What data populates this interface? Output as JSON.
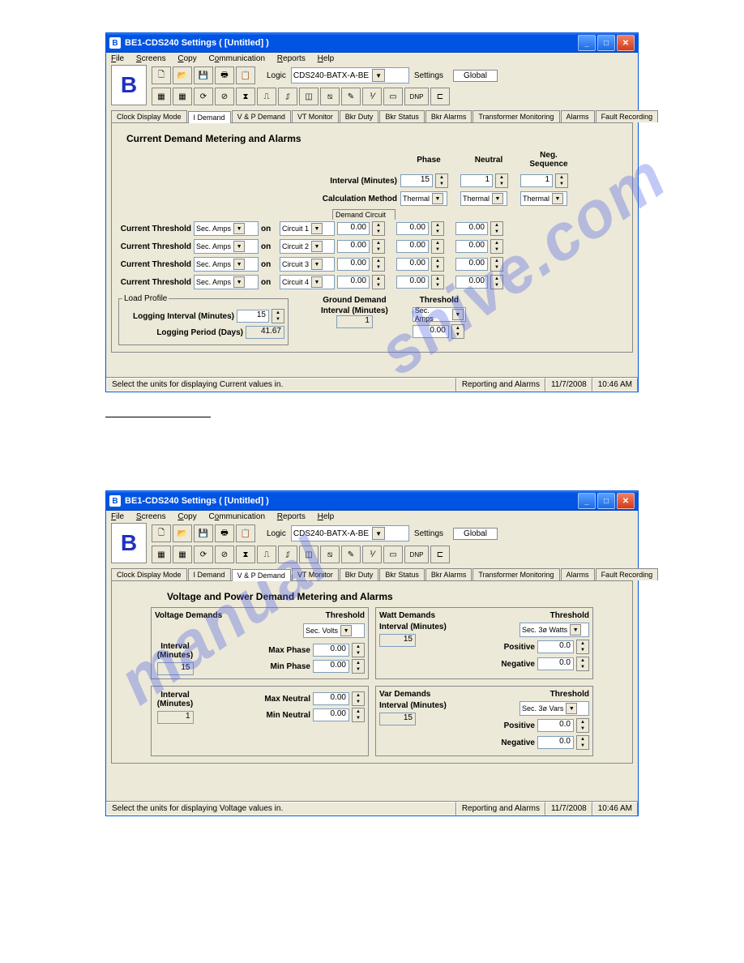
{
  "window": {
    "title": "BE1-CDS240 Settings    ( [Untitled] )"
  },
  "menu": {
    "file": "File",
    "screens": "Screens",
    "copy": "Copy",
    "comm": "Communication",
    "reports": "Reports",
    "help": "Help"
  },
  "tb": {
    "logic": "Logic",
    "logicVal": "CDS240-BATX-A-BE",
    "settings": "Settings",
    "global": "Global",
    "dnp": "DNP"
  },
  "tabs": {
    "t0": "Clock Display Mode",
    "t1": "I Demand",
    "t2": "V & P Demand",
    "t3": "VT Monitor",
    "t4": "Bkr Duty",
    "t5": "Bkr Status",
    "t6": "Bkr Alarms",
    "t7": "Transformer Monitoring",
    "t8": "Alarms",
    "t9": "Fault Recording"
  },
  "p1": {
    "title": "Current Demand Metering and Alarms",
    "phase": "Phase",
    "neutral": "Neutral",
    "negseq": "Neg. Sequence",
    "interval": "Interval (Minutes)",
    "iv_p": "15",
    "iv_n": "1",
    "iv_s": "1",
    "calc": "Calculation Method",
    "therm": "Thermal",
    "dcircuit": "Demand Circuit",
    "cth": "Current Threshold",
    "secamps": "Sec. Amps",
    "on": "on",
    "c1": "Circuit 1",
    "c2": "Circuit 2",
    "c3": "Circuit 3",
    "c4": "Circuit 4",
    "v": "0.00",
    "lp": "Load Profile",
    "loi": "Logging Interval (Minutes)",
    "loiv": "15",
    "lpd": "Logging Period (Days)",
    "lpdv": "41.67",
    "gd": "Ground Demand",
    "gim": "Interval (Minutes)",
    "giv": "1",
    "thr": "Threshold",
    "tsa": "Sec. Amps",
    "tv": "0.00"
  },
  "p2": {
    "title": "Voltage and Power Demand Metering and Alarms",
    "vd": "Voltage Demands",
    "thr": "Threshold",
    "secv": "Sec. Volts",
    "im": "Interval (Minutes)",
    "i15": "15",
    "i1": "1",
    "maxp": "Max Phase",
    "minp": "Min Phase",
    "maxn": "Max Neutral",
    "minn": "Min Neutral",
    "v": "0.00",
    "wd": "Watt Demands",
    "s3w": "Sec. 3ø Watts",
    "pos": "Positive",
    "neg": "Negative",
    "v0": "0.0",
    "vard": "Var Demands",
    "s3v": "Sec. 3ø Vars"
  },
  "status": {
    "s1a": "Select the units for displaying Current values in.",
    "s1b": "Select the units for displaying Voltage values in.",
    "s2": "Reporting and Alarms",
    "s3": "11/7/2008",
    "s4": "10:46 AM"
  }
}
